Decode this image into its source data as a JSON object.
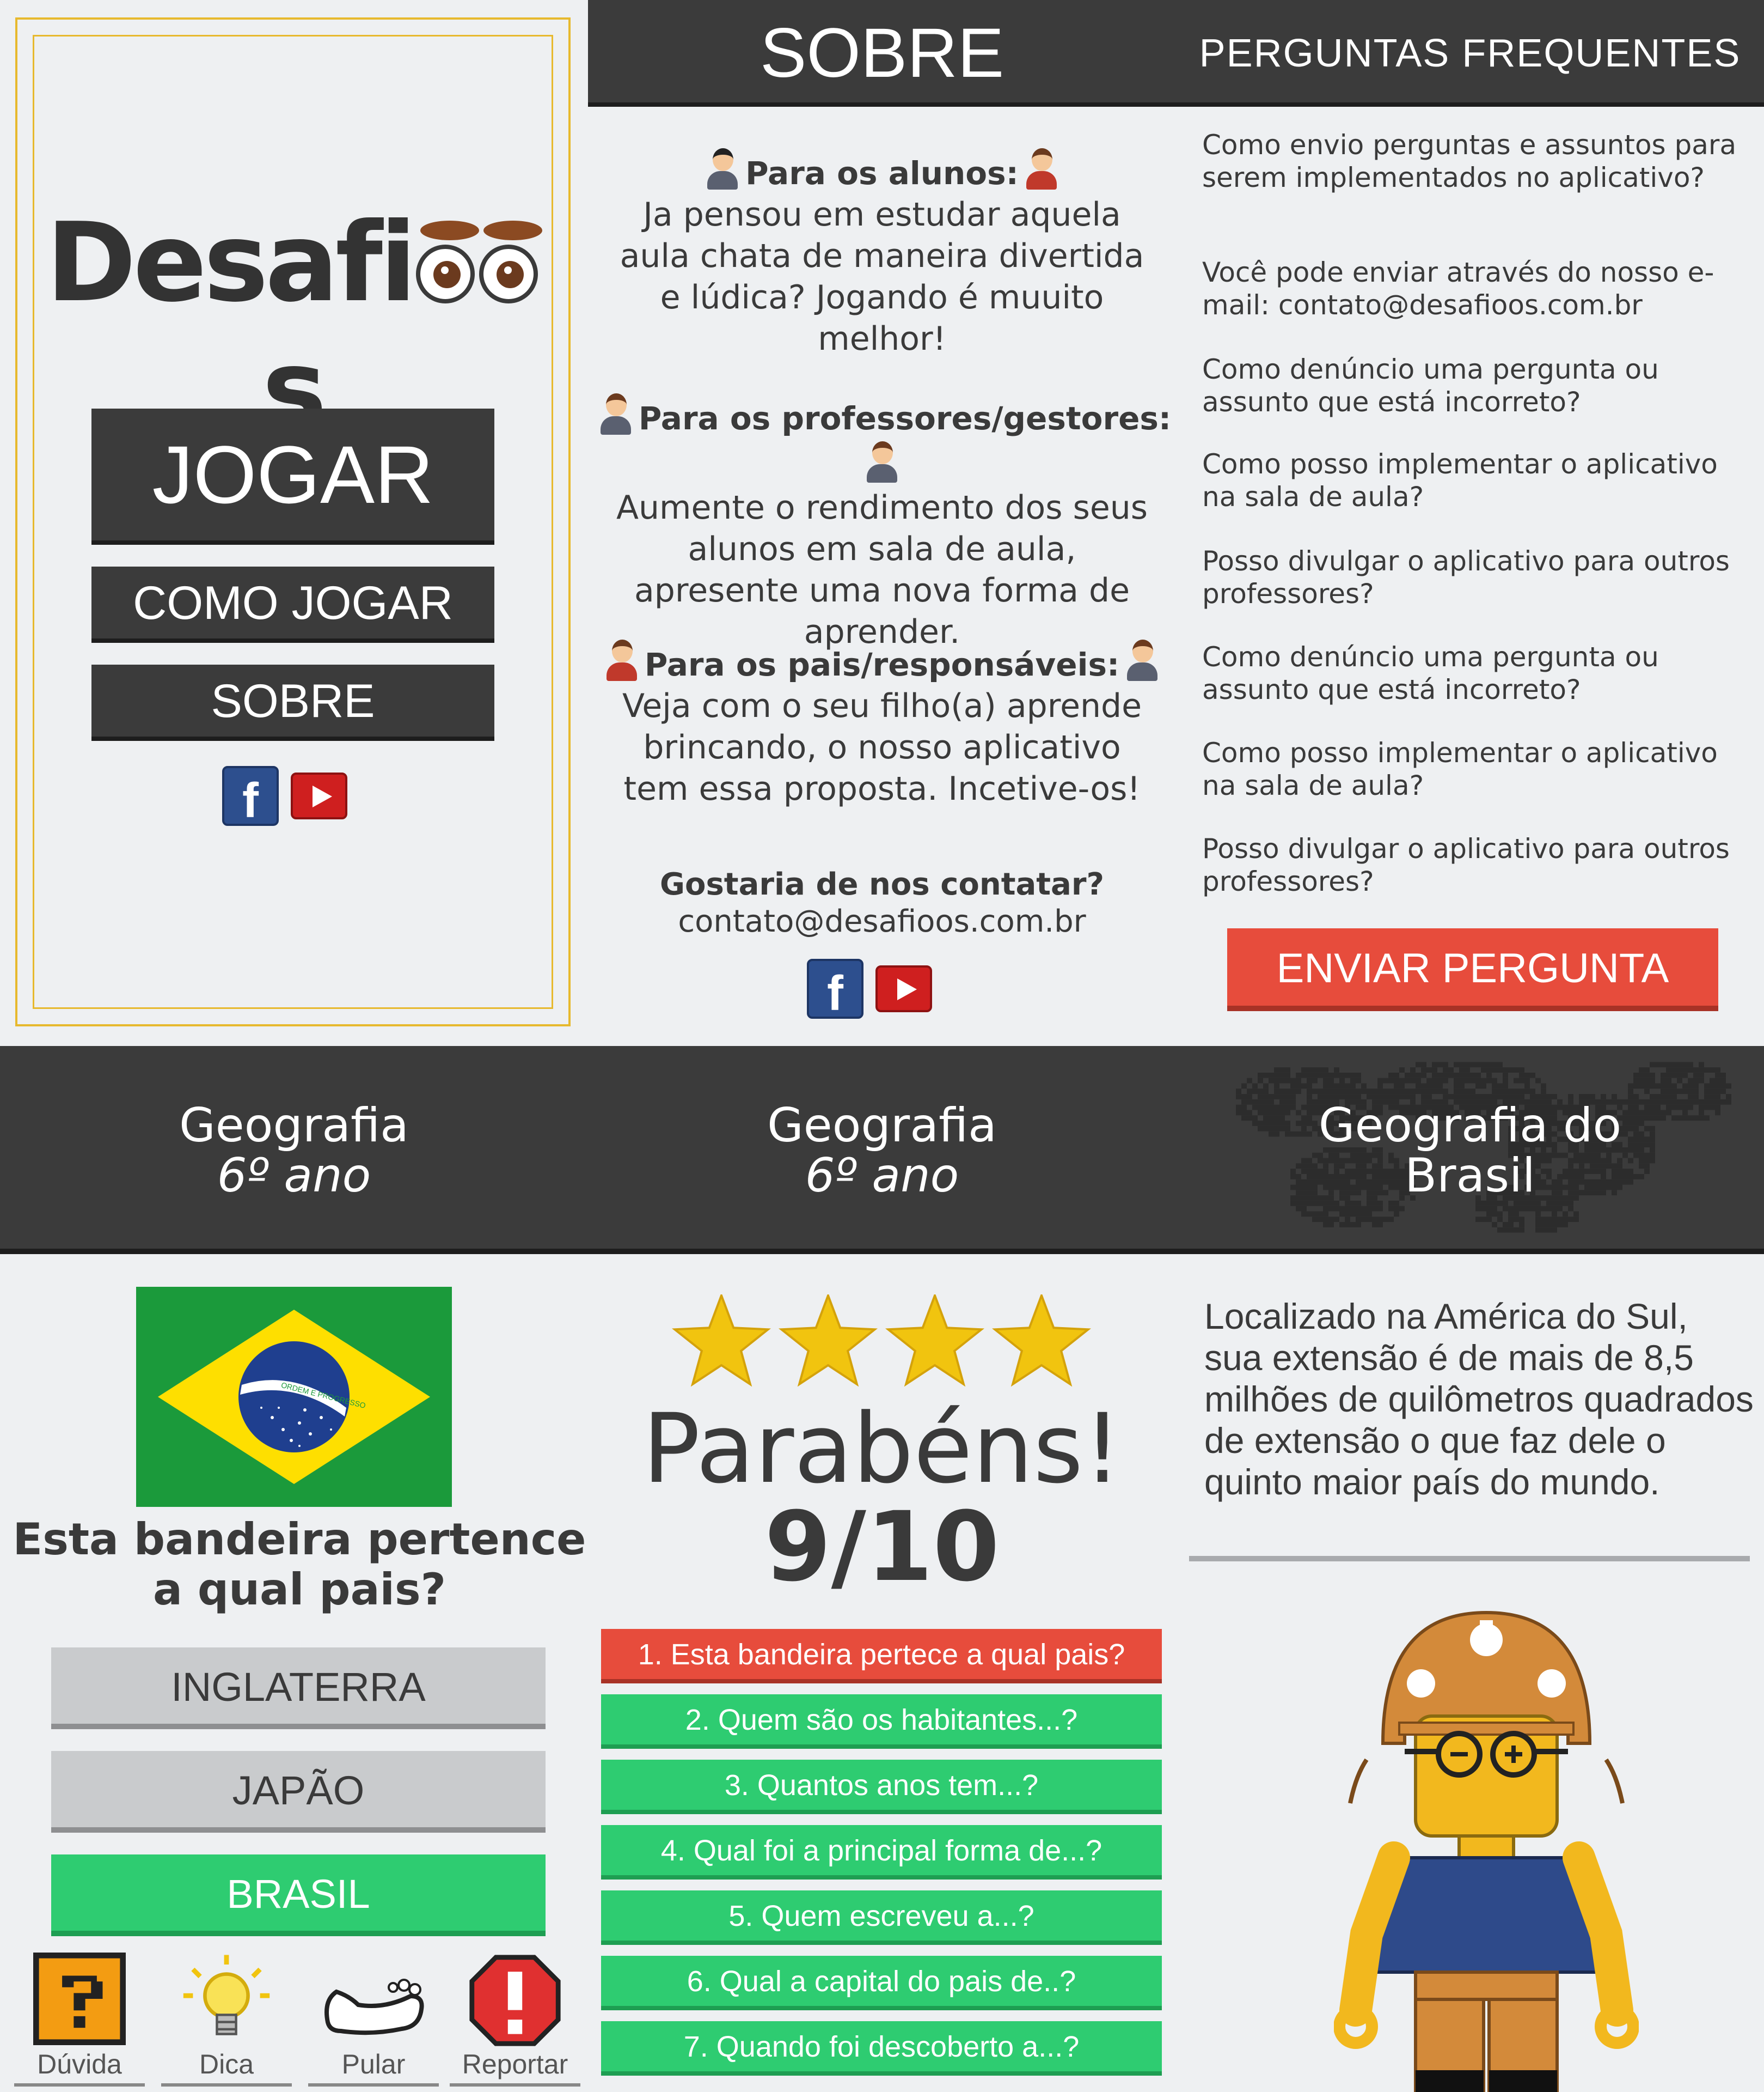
{
  "home": {
    "logo_text_prefix": "Desafi",
    "logo_text_suffix": "s",
    "play_label": "JOGAR",
    "how_to_label": "COMO JOGAR",
    "about_label": "SOBRE"
  },
  "about": {
    "header": "SOBRE",
    "students_title": "Para os alunos:",
    "students_text": "Ja pensou em estudar aquela aula chata de maneira divertida e lúdica? Jogando é muuito melhor!",
    "teachers_title": "Para os professores/gestores:",
    "teachers_text": "Aumente o rendimento dos seus alunos em sala de aula, apresente uma nova forma de aprender.",
    "parents_title": "Para os pais/responsáveis:",
    "parents_text": "Veja com o seu filho(a) aprende brincando, o nosso aplicativo tem essa proposta. Incetive-os!",
    "contact_title": "Gostaria de nos contatar?",
    "contact_email": "contato@desafioos.com.br"
  },
  "faq": {
    "header": "PERGUNTAS FREQUENTES",
    "items": [
      "Como envio perguntas e assuntos para serem implementados no aplicativo?",
      "Você pode enviar através do nosso e-mail: contato@desafioos.com.br",
      "Como denúncio uma pergunta ou assunto que está incorreto?",
      "Como posso implementar o aplicativo na sala de aula?",
      "Posso divulgar o aplicativo para outros professores?",
      "Como denúncio uma pergunta ou assunto que está incorreto?",
      "Como posso implementar o aplicativo na sala de aula?",
      "Posso divulgar o aplicativo para outros professores?"
    ],
    "send_button": "ENVIAR PERGUNTA"
  },
  "categories": [
    {
      "title": "Geografia",
      "subtitle": "6º ano"
    },
    {
      "title": "Geografia",
      "subtitle": "6º ano"
    },
    {
      "title": "Geografia do Brasil",
      "subtitle": ""
    }
  ],
  "quiz": {
    "flag_motto": "ORDEM E PROGRESSO",
    "question": "Esta bandeira pertence a qual pais?",
    "answers": [
      "INGLATERRA",
      "JAPÃO",
      "BRASIL"
    ],
    "tools": [
      "Dúvida",
      "Dica",
      "Pular",
      "Reportar"
    ]
  },
  "result": {
    "stars": 4,
    "title": "Parabéns!",
    "score": "9/10",
    "items": [
      {
        "text": "1. Esta bandeira pertece a qual pais?",
        "status": "wrong"
      },
      {
        "text": "2. Quem são os habitantes...?",
        "status": "right"
      },
      {
        "text": "3. Quantos anos tem...?",
        "status": "right"
      },
      {
        "text": "4. Qual foi a principal forma de...?",
        "status": "right"
      },
      {
        "text": "5. Quem escreveu a...?",
        "status": "right"
      },
      {
        "text": "6. Qual a capital do pais de..?",
        "status": "right"
      },
      {
        "text": "7. Quando foi descoberto a...?",
        "status": "right"
      }
    ]
  },
  "info": {
    "text": "Localizado na América do Sul, sua extensão é de mais de 8,5 milhões de quilômetros quadrados de extensão o que faz dele o quinto maior país do mundo."
  },
  "colors": {
    "dark": "#3b3b3b",
    "accent_red": "#e74c3c",
    "accent_green": "#2ecc71",
    "frame_yellow": "#e7b92e",
    "background": "#eef0f2"
  }
}
